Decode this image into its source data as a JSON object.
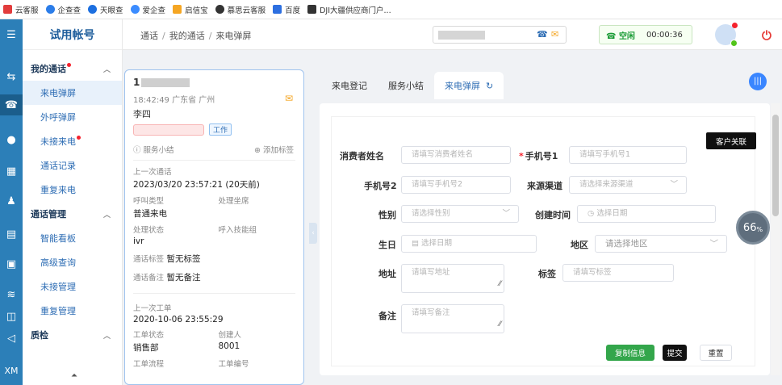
{
  "bookmarks": [
    {
      "label": "云客服",
      "color": "#e23c3c"
    },
    {
      "label": "企查查",
      "color": "#2b7de9"
    },
    {
      "label": "天眼查",
      "color": "#1c6fe0"
    },
    {
      "label": "爱企查",
      "color": "#3b8cff"
    },
    {
      "label": "启信宝",
      "color": "#f5a623"
    },
    {
      "label": "慕思云客服",
      "color": "#333333"
    },
    {
      "label": "百度",
      "color": "#2d6fe0"
    },
    {
      "label": "DJI大疆供应商门户...",
      "color": "#333333"
    }
  ],
  "sidebar": {
    "title": "试用帐号",
    "groups": [
      {
        "label": "我的通话",
        "items": [
          "来电弹屏",
          "外呼弹屏",
          "未接来电",
          "通话记录",
          "重复来电"
        ]
      },
      {
        "label": "通话管理",
        "items": [
          "智能看板",
          "高级查询",
          "未接管理",
          "重复管理"
        ]
      },
      {
        "label": "质检"
      }
    ],
    "xm": "XM"
  },
  "topbar": {
    "breadcrumb": [
      "通话",
      "我的通话",
      "来电弹屏"
    ],
    "status": "空闲",
    "timer": "00:00:36"
  },
  "call_card": {
    "number_prefix": "1",
    "time_location": "18:42:49 广东省 广州",
    "name": "李四",
    "tag_work": "工作",
    "summary_link": "服务小结",
    "add_tag": "添加标签",
    "last_call_label": "上一次通话",
    "last_call_value": "2023/03/20 23:57:21 (20天前)",
    "call_type_label": "呼叫类型",
    "handler_label": "处理坐席",
    "call_type_value": "普通来电",
    "handle_status_label": "处理状态",
    "skill_group_label": "呼入技能组",
    "handle_status_value": "ivr",
    "call_tag_label": "通话标签",
    "call_tag_value": "暂无标签",
    "call_note_label": "通话备注",
    "call_note_value": "暂无备注",
    "last_order_label": "上一次工单",
    "last_order_value": "2020-10-06 23:55:29",
    "order_status_label": "工单状态",
    "creator_label": "创建人",
    "order_status_value": "销售部",
    "creator_value": "8001",
    "order_flow_label": "工单流程",
    "order_no_label": "工单编号"
  },
  "tabs": [
    "来电登记",
    "服务小结",
    "来电弹屏"
  ],
  "form": {
    "customer_link": "客户关联",
    "name_label": "消费者姓名",
    "name_ph": "请填写消费者姓名",
    "phone1_label": "手机号1",
    "phone1_ph": "请填写手机号1",
    "phone2_label": "手机号2",
    "phone2_ph": "请填写手机号2",
    "channel_label": "来源渠道",
    "channel_ph": "请选择来源渠道",
    "gender_label": "性别",
    "gender_ph": "请选择性别",
    "created_label": "创建时间",
    "created_ph": "选择日期",
    "birthday_label": "生日",
    "birthday_ph": "选择日期",
    "region_label": "地区",
    "region_ph": "请选择地区",
    "address_label": "地址",
    "address_ph": "请填写地址",
    "tag_label": "标签",
    "tag_ph": "请填写标签",
    "note_label": "备注",
    "note_ph": "请填写备注",
    "copy_btn": "复制信息",
    "submit_btn": "提交",
    "reset_btn": "重置"
  },
  "progress_percent": "66"
}
